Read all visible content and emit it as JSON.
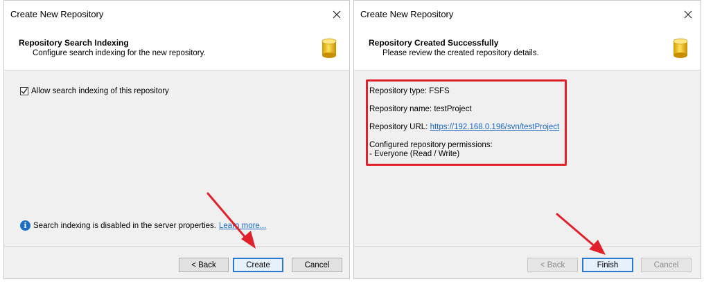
{
  "left_dialog": {
    "window_title": "Create New Repository",
    "header_title": "Repository Search Indexing",
    "header_subtitle": "Configure search indexing for the new repository.",
    "checkbox_label": "Allow search indexing of this repository",
    "checkbox_checked": true,
    "info_text": "Search indexing is disabled in the server properties.",
    "info_link": "Learn more...",
    "buttons": {
      "back": "< Back",
      "create": "Create",
      "cancel": "Cancel"
    }
  },
  "right_dialog": {
    "window_title": "Create New Repository",
    "header_title": "Repository Created Successfully",
    "header_subtitle": "Please review the created repository details.",
    "details": {
      "type": "Repository type: FSFS",
      "name": "Repository name: testProject",
      "url_label": "Repository URL: ",
      "url": "https://192.168.0.196/svn/testProject",
      "permissions_title": "Configured repository permissions:",
      "permissions_entry": "- Everyone (Read / Write)"
    },
    "buttons": {
      "back": "< Back",
      "finish": "Finish",
      "cancel": "Cancel"
    }
  },
  "colors": {
    "annotation_red": "#e0202a",
    "link_blue": "#1a66c2",
    "default_button_border": "#2b78d0"
  },
  "icons": {
    "close": "close-icon",
    "database": "database-icon",
    "info": "info-icon",
    "check": "checkmark-icon"
  }
}
